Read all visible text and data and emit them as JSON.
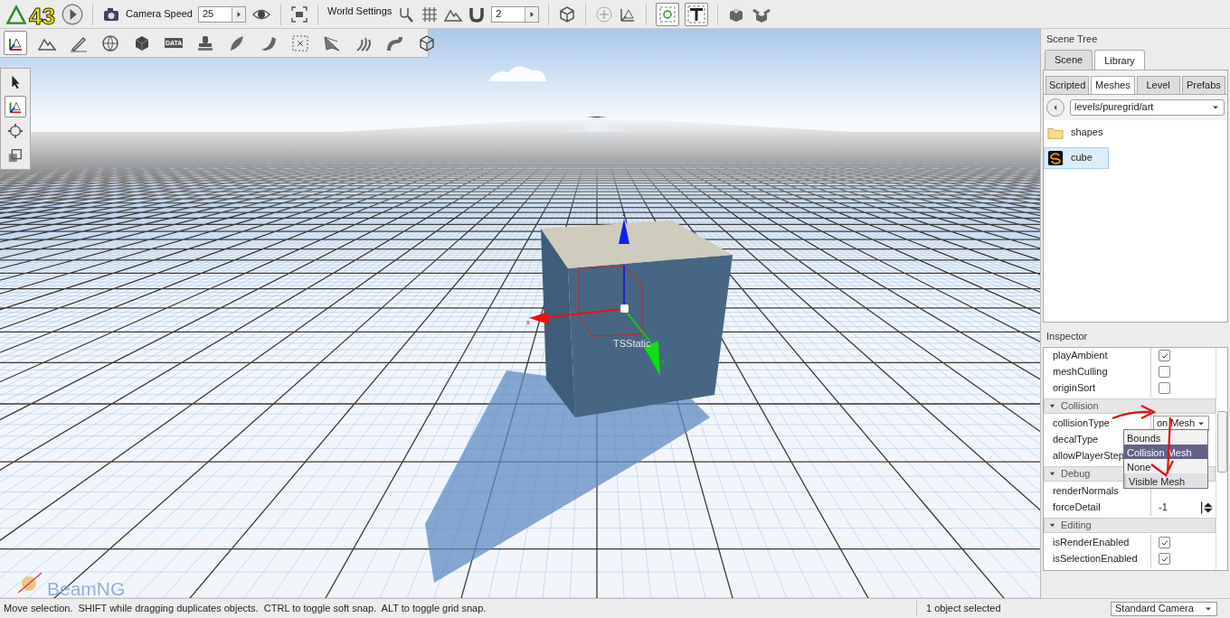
{
  "toolbar": {
    "logo_overlay": "43",
    "camera_speed": {
      "label": "Camera Speed",
      "value": "25"
    },
    "world_settings": "World Settings",
    "snap": {
      "value": "2"
    },
    "view_toggles": [
      {
        "selected": true
      },
      {
        "selected": true
      }
    ]
  },
  "editor_tools": [
    {
      "selected": true
    },
    {
      "selected": false
    },
    {
      "selected": false
    },
    {
      "selected": false
    },
    {
      "selected": false
    },
    {
      "selected": false,
      "label": "DATA"
    },
    {
      "selected": false
    },
    {
      "selected": false
    },
    {
      "selected": false
    },
    {
      "selected": false
    },
    {
      "selected": false
    },
    {
      "selected": false
    },
    {
      "selected": false
    },
    {
      "selected": false
    }
  ],
  "transform_tools": [
    {
      "selected": false
    },
    {
      "selected": true
    },
    {
      "selected": false
    },
    {
      "selected": false
    }
  ],
  "viewport": {
    "object_label": "TSStatic",
    "axis_labels": [
      "z",
      "x",
      "y"
    ],
    "watermark": "BeamNG"
  },
  "scene_tree": {
    "title": "Scene Tree",
    "tabs": [
      {
        "label": "Scene",
        "selected": false
      },
      {
        "label": "Library",
        "selected": true
      }
    ],
    "subtabs": [
      {
        "label": "Scripted",
        "selected": false
      },
      {
        "label": "Meshes",
        "selected": true
      },
      {
        "label": "Level",
        "selected": false
      },
      {
        "label": "Prefabs",
        "selected": false
      }
    ],
    "path": "levels/puregrid/art",
    "items": [
      {
        "kind": "folder",
        "label": "shapes",
        "selected": false
      },
      {
        "kind": "mesh",
        "label": "cube",
        "selected": true
      }
    ]
  },
  "inspector": {
    "title": "Inspector",
    "sections": [
      {
        "rows": [
          {
            "name": "playAmbient",
            "kind": "checkbox",
            "checked": true
          },
          {
            "name": "meshCulling",
            "kind": "checkbox",
            "checked": false
          },
          {
            "name": "originSort",
            "kind": "checkbox",
            "checked": false
          }
        ]
      },
      {
        "title": "Collision",
        "expanded": true,
        "rows": [
          {
            "name": "collisionType",
            "kind": "dropdown",
            "value": "on Mesh"
          },
          {
            "name": "decalType",
            "kind": "text"
          },
          {
            "name": "allowPlayerStep",
            "kind": "text"
          }
        ]
      },
      {
        "title": "Debug",
        "expanded": true,
        "rows": [
          {
            "name": "renderNormals",
            "kind": "text"
          },
          {
            "name": "forceDetail",
            "kind": "spinner",
            "value": "-1"
          }
        ]
      },
      {
        "title": "Editing",
        "expanded": true,
        "rows": [
          {
            "name": "isRenderEnabled",
            "kind": "checkbox",
            "checked": true
          },
          {
            "name": "isSelectionEnabled",
            "kind": "checkbox",
            "checked": true
          }
        ]
      }
    ],
    "dropdown_options": [
      {
        "label": "Bounds",
        "selected": false,
        "hovered": false
      },
      {
        "label": "Collision Mesh",
        "selected": true,
        "hovered": false
      },
      {
        "label": "None",
        "selected": false,
        "hovered": false
      },
      {
        "label": "Visible Mesh",
        "selected": false,
        "hovered": true
      }
    ]
  },
  "status_bar": {
    "hint": "Move selection.  SHIFT while dragging duplicates objects.  CTRL to toggle soft snap.  ALT to toggle grid snap.",
    "selection": "1 object selected",
    "camera": "Standard Camera"
  }
}
